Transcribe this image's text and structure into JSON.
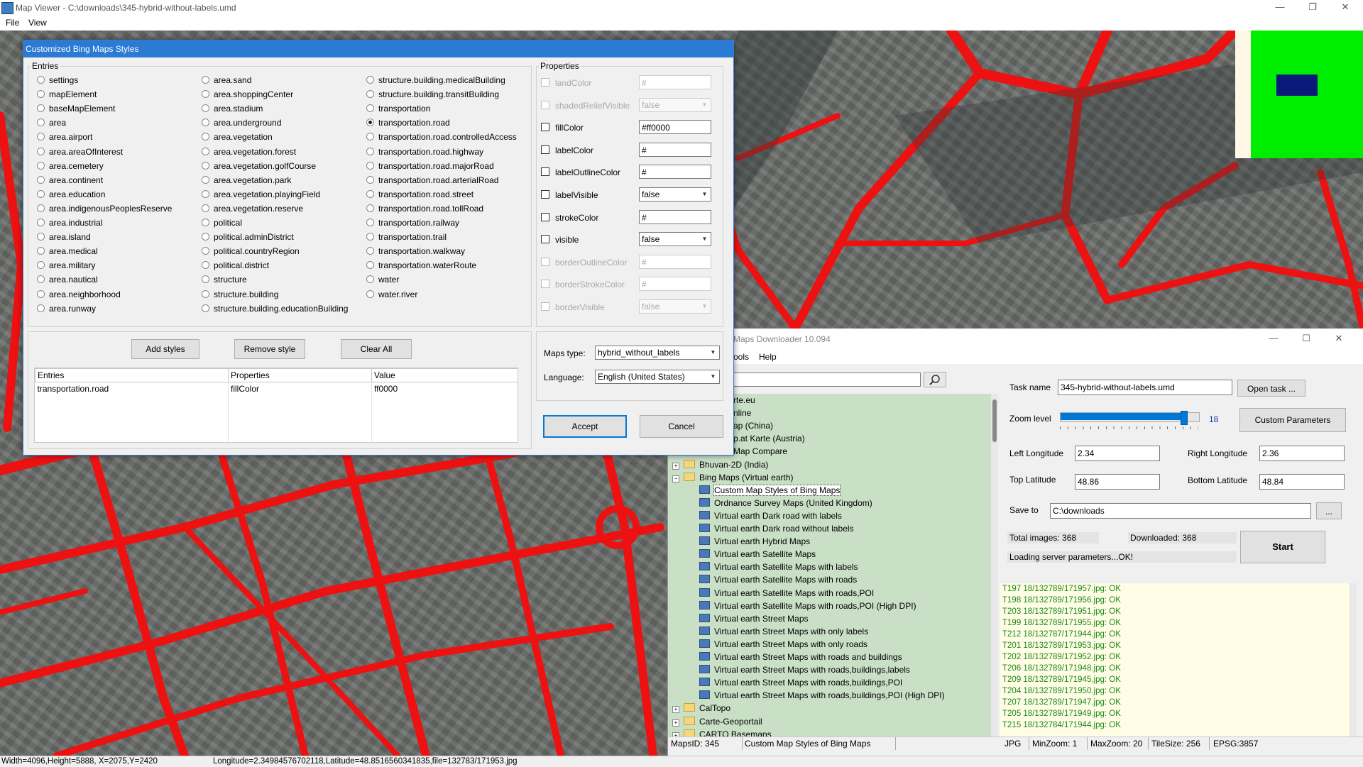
{
  "window": {
    "title": "Map Viewer - C:\\downloads\\345-hybrid-without-labels.umd",
    "menu": [
      "File",
      "View"
    ],
    "controls": {
      "minimize": "—",
      "maximize": "❐",
      "close": "✕"
    }
  },
  "statusbar": {
    "size": "Width=4096,Height=5888, X=2075,Y=2420",
    "coords": "Longitude=2.34984576702118,Latitude=48.8516560341835,file=132783/171953.jpg"
  },
  "dialog": {
    "title": "Customized Bing Maps Styles",
    "entries_label": "Entries",
    "entries_col1": [
      "settings",
      "mapElement",
      "baseMapElement",
      "area",
      "area.airport",
      "area.areaOfInterest",
      "area.cemetery",
      "area.continent",
      "area.education",
      "area.indigenousPeoplesReserve",
      "area.industrial",
      "area.island",
      "area.medical",
      "area.military",
      "area.nautical",
      "area.neighborhood",
      "area.runway"
    ],
    "entries_col2": [
      "area.sand",
      "area.shoppingCenter",
      "area.stadium",
      "area.underground",
      "area.vegetation",
      "area.vegetation.forest",
      "area.vegetation.golfCourse",
      "area.vegetation.park",
      "area.vegetation.playingField",
      "area.vegetation.reserve",
      "political",
      "political.adminDistrict",
      "political.countryRegion",
      "political.district",
      "structure",
      "structure.building",
      "structure.building.educationBuilding"
    ],
    "entries_col3": [
      "structure.building.medicalBuilding",
      "structure.building.transitBuilding",
      "transportation",
      "transportation.road",
      "transportation.road.controlledAccess",
      "transportation.road.highway",
      "transportation.road.majorRoad",
      "transportation.road.arterialRoad",
      "transportation.road.street",
      "transportation.road.tollRoad",
      "transportation.railway",
      "transportation.trail",
      "transportation.walkway",
      "transportation.waterRoute",
      "water",
      "water.river"
    ],
    "selected_entry": "transportation.road",
    "properties_label": "Properties",
    "properties": [
      {
        "name": "landColor",
        "value": "#",
        "kind": "text",
        "enabled": false
      },
      {
        "name": "shadedReliefVisible",
        "value": "false",
        "kind": "combo",
        "enabled": false
      },
      {
        "name": "fillColor",
        "value": "#ff0000",
        "kind": "text",
        "enabled": true
      },
      {
        "name": "labelColor",
        "value": "#",
        "kind": "text",
        "enabled": true
      },
      {
        "name": "labelOutlineColor",
        "value": "#",
        "kind": "text",
        "enabled": true
      },
      {
        "name": "labelVisible",
        "value": "false",
        "kind": "combo",
        "enabled": true
      },
      {
        "name": "strokeColor",
        "value": "#",
        "kind": "text",
        "enabled": true
      },
      {
        "name": "visible",
        "value": "false",
        "kind": "combo",
        "enabled": true
      },
      {
        "name": "borderOutlineColor",
        "value": "#",
        "kind": "text",
        "enabled": false
      },
      {
        "name": "borderStrokeColor",
        "value": "#",
        "kind": "text",
        "enabled": false
      },
      {
        "name": "borderVisible",
        "value": "false",
        "kind": "combo",
        "enabled": false
      }
    ],
    "buttons": {
      "add": "Add styles",
      "remove": "Remove style",
      "clear": "Clear All",
      "accept": "Accept",
      "cancel": "Cancel"
    },
    "table": {
      "headers": [
        "Entries",
        "Properties",
        "Value"
      ],
      "rows": [
        [
          "transportation.road",
          "fillColor",
          "ff0000"
        ]
      ]
    },
    "maps_type_label": "Maps type:",
    "maps_type": "hybrid_without_labels",
    "language_label": "Language:",
    "language": "English (United States)"
  },
  "downloader": {
    "title": "Maps Downloader 10.094",
    "menu": [
      "ools",
      "Help"
    ],
    "controls": {
      "minimize": "—",
      "maximize": "☐",
      "close": "✕"
    },
    "search_icon": "search-icon",
    "tree": [
      {
        "label": "rte.eu",
        "kind": "partial"
      },
      {
        "label": "nline",
        "kind": "partial"
      },
      {
        "label": "ap (China)",
        "kind": "partial"
      },
      {
        "label": "p.at Karte (Austria)",
        "kind": "partial"
      },
      {
        "label": "Map Compare",
        "kind": "partial"
      },
      {
        "label": "Bhuvan-2D (India)",
        "kind": "folder",
        "pm": "+"
      },
      {
        "label": "Bing Maps (Virtual earth)",
        "kind": "folder",
        "pm": "−"
      },
      {
        "label": "Custom Map Styles of Bing Maps",
        "kind": "item",
        "selected": true
      },
      {
        "label": "Ordnance Survey Maps (United Kingdom)",
        "kind": "item"
      },
      {
        "label": "Virtual earth Dark road with labels",
        "kind": "item"
      },
      {
        "label": "Virtual earth Dark road without labels",
        "kind": "item"
      },
      {
        "label": "Virtual earth Hybrid Maps",
        "kind": "item"
      },
      {
        "label": "Virtual earth Satellite Maps",
        "kind": "item"
      },
      {
        "label": "Virtual earth Satellite Maps with labels",
        "kind": "item"
      },
      {
        "label": "Virtual earth Satellite Maps with roads",
        "kind": "item"
      },
      {
        "label": "Virtual earth Satellite Maps with roads,POI",
        "kind": "item"
      },
      {
        "label": "Virtual earth Satellite Maps with roads,POI (High DPI)",
        "kind": "item"
      },
      {
        "label": "Virtual earth Street Maps",
        "kind": "item"
      },
      {
        "label": "Virtual earth Street Maps with only labels",
        "kind": "item"
      },
      {
        "label": "Virtual earth Street Maps with only roads",
        "kind": "item"
      },
      {
        "label": "Virtual earth Street Maps with roads and buildings",
        "kind": "item"
      },
      {
        "label": "Virtual earth Street Maps with roads,buildings,labels",
        "kind": "item"
      },
      {
        "label": "Virtual earth Street Maps with roads,buildings,POI",
        "kind": "item"
      },
      {
        "label": "Virtual earth Street Maps with roads,buildings,POI (High DPI)",
        "kind": "item"
      },
      {
        "label": "CalTopo",
        "kind": "folder",
        "pm": "+"
      },
      {
        "label": "Carte-Geoportail",
        "kind": "folder",
        "pm": "+"
      },
      {
        "label": "CARTO Basemaps",
        "kind": "folder",
        "pm": "+"
      }
    ],
    "task_name_label": "Task name",
    "task_name": "345-hybrid-without-labels.umd",
    "open_task": "Open task ...",
    "zoom_label": "Zoom level",
    "zoom_value": "18",
    "zoom_fraction": 0.89,
    "custom_params": "Custom Parameters",
    "left_lon_label": "Left Longitude",
    "left_lon": "2.34",
    "right_lon_label": "Right Longitude",
    "right_lon": "2.36",
    "top_lat_label": "Top Latitude",
    "top_lat": "48.86",
    "bottom_lat_label": "Bottom Latitude",
    "bottom_lat": "48.84",
    "save_to_label": "Save to",
    "save_to": "C:\\downloads",
    "browse": "...",
    "total_images": "Total images: 368",
    "downloaded": "Downloaded: 368",
    "loading": "Loading server parameters...OK!",
    "start": "Start",
    "log": [
      "T197 18/132789/171957.jpg: OK",
      "T198 18/132789/171956.jpg: OK",
      "T203 18/132789/171951.jpg: OK",
      "T199 18/132789/171955.jpg: OK",
      "T212 18/132787/171944.jpg: OK",
      "T201 18/132789/171953.jpg: OK",
      "T202 18/132789/171952.jpg: OK",
      "T206 18/132789/171948.jpg: OK",
      "T209 18/132789/171945.jpg: OK",
      "T204 18/132789/171950.jpg: OK",
      "T207 18/132789/171947.jpg: OK",
      "T205 18/132789/171949.jpg: OK",
      "T215 18/132784/171944.jpg: OK"
    ],
    "status": {
      "maps_id": "MapsID: 345",
      "name": "Custom Map Styles of Bing Maps",
      "format": "JPG",
      "min_zoom": "MinZoom: 1",
      "max_zoom": "MaxZoom: 20",
      "tile_size": "TileSize: 256",
      "epsg": "EPSG:3857"
    }
  }
}
